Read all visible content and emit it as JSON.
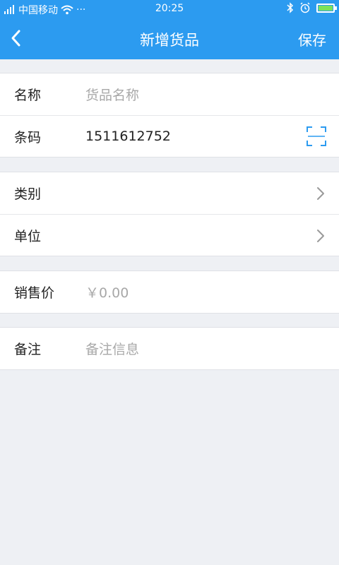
{
  "status_bar": {
    "carrier": "中国移动",
    "time": "20:25",
    "dots": "···"
  },
  "nav": {
    "title": "新增货品",
    "save_label": "保存",
    "back_icon": "chevron-left-icon"
  },
  "form": {
    "name": {
      "label": "名称",
      "placeholder": "货品名称"
    },
    "barcode": {
      "label": "条码",
      "value": "1511612752",
      "icon": "scan-icon"
    },
    "category": {
      "label": "类别",
      "icon": "chevron-right-icon"
    },
    "unit": {
      "label": "单位",
      "icon": "chevron-right-icon"
    },
    "price": {
      "label": "销售价",
      "placeholder": "￥0.00"
    },
    "note": {
      "label": "备注",
      "placeholder": "备注信息"
    }
  },
  "colors": {
    "accent": "#2c9bf0",
    "background": "#eef0f4",
    "placeholder": "#a8a8a8"
  }
}
